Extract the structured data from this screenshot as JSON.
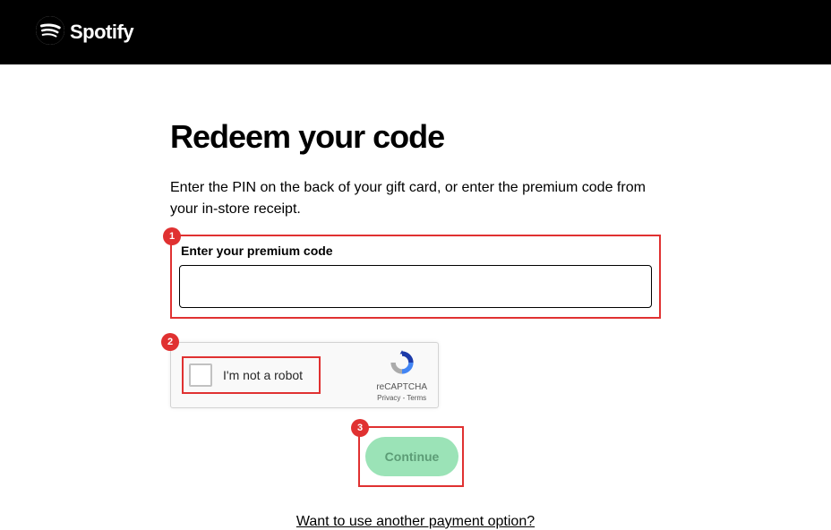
{
  "header": {
    "brand": "Spotify"
  },
  "page": {
    "title": "Redeem your code",
    "instructions": "Enter the PIN on the back of your gift card, or enter the premium code from your in-store receipt."
  },
  "form": {
    "code_label": "Enter your premium code",
    "code_value": ""
  },
  "captcha": {
    "label": "I'm not a robot",
    "brand": "reCAPTCHA",
    "links": "Privacy - Terms"
  },
  "cta": {
    "continue": "Continue"
  },
  "alt": {
    "link": "Want to use another payment option?"
  },
  "annotations": {
    "step1": "1",
    "step2": "2",
    "step3": "3"
  },
  "colors": {
    "annotation": "#e03131",
    "button_bg": "#9be3b7",
    "button_text": "#5c9c76"
  }
}
